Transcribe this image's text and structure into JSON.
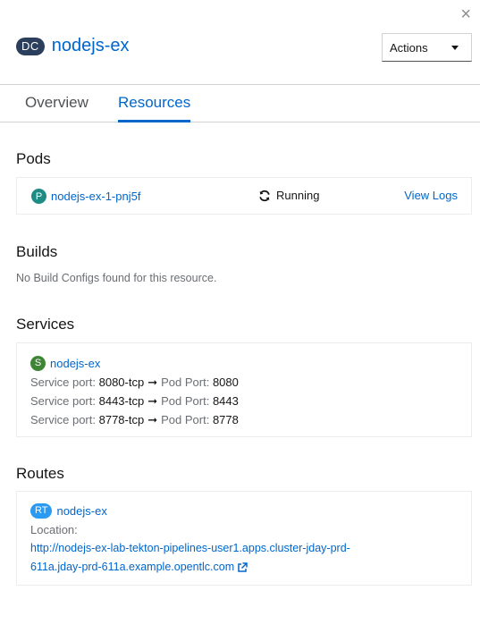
{
  "close_icon": "×",
  "header": {
    "badge": "DC",
    "name": "nodejs-ex",
    "actions_label": "Actions"
  },
  "tabs": [
    {
      "label": "Overview",
      "active": false
    },
    {
      "label": "Resources",
      "active": true
    }
  ],
  "pods": {
    "title": "Pods",
    "items": [
      {
        "badge": "P",
        "name": "nodejs-ex-1-pnj5f",
        "status": "Running",
        "action": "View Logs"
      }
    ]
  },
  "builds": {
    "title": "Builds",
    "empty_text": "No Build Configs found for this resource."
  },
  "services": {
    "title": "Services",
    "badge": "S",
    "name": "nodejs-ex",
    "service_port_label": "Service port:",
    "pod_port_label": "Pod Port:",
    "ports": [
      {
        "service_port": "8080-tcp",
        "pod_port": "8080"
      },
      {
        "service_port": "8443-tcp",
        "pod_port": "8443"
      },
      {
        "service_port": "8778-tcp",
        "pod_port": "8778"
      }
    ]
  },
  "routes": {
    "title": "Routes",
    "badge": "RT",
    "name": "nodejs-ex",
    "location_label": "Location:",
    "url_line1": "http://nodejs-ex-lab-tekton-pipelines-user1.apps.cluster-jday-prd-",
    "url_line2": "611a.jday-prd-611a.example.opentlc.com"
  },
  "colors": {
    "link": "#0066cc",
    "dc_badge": "#2b3e5c",
    "pod_badge": "#1e8c84",
    "service_badge": "#3e8635",
    "route_badge": "#2b9af3"
  }
}
